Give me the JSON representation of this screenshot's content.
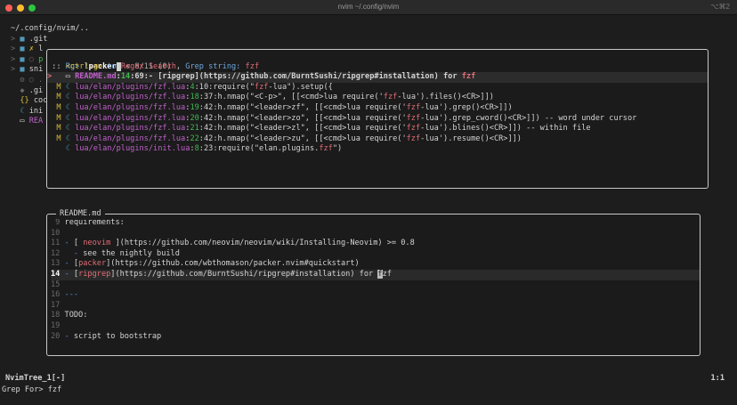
{
  "window": {
    "title": "nvim ~/.config/nvim",
    "shortcut": "⌥⌘2"
  },
  "colors": {
    "bg": "#1d1d1d",
    "path": "#c061cb",
    "num": "#3fb950",
    "mod": "#d7ba37",
    "match": "#e06c75",
    "icon": "#519aba",
    "dim": "#6a6a6a",
    "text": "#d4d4d4",
    "prompt": "#6fa8dc",
    "link": "#e06c75",
    "bullet": "#5b8fd6",
    "bold": "#ffffff"
  },
  "tree": [
    [
      {
        "t": "~/.config/nvim/..",
        "c": "text"
      }
    ],
    [
      {
        "t": "> ",
        "c": "dim"
      },
      {
        "t": "■ ",
        "c": "icon"
      },
      {
        "t": ".git",
        "c": "text"
      }
    ],
    [
      {
        "t": "> ",
        "c": "dim"
      },
      {
        "t": "■ ",
        "c": "icon"
      },
      {
        "t": "✗ ",
        "c": "mod"
      },
      {
        "t": "l",
        "c": "text"
      }
    ],
    [
      {
        "t": "> ",
        "c": "dim"
      },
      {
        "t": "■ ",
        "c": "icon"
      },
      {
        "t": "○ ",
        "c": "dim"
      },
      {
        "t": "p",
        "c": "num"
      }
    ],
    [
      {
        "t": "> ",
        "c": "dim"
      },
      {
        "t": "■ ",
        "c": "icon"
      },
      {
        "t": "sni",
        "c": "text"
      }
    ],
    [
      {
        "t": "  ⚙ ",
        "c": "dim"
      },
      {
        "t": "○ .",
        "c": "dim"
      }
    ],
    [
      {
        "t": "  ◆ ",
        "c": "dim"
      },
      {
        "t": ".gi",
        "c": "text"
      }
    ],
    [
      {
        "t": "  {} ",
        "c": "mod"
      },
      {
        "t": "coc",
        "c": "text"
      }
    ],
    [
      {
        "t": "  ☾ ",
        "c": "icon"
      },
      {
        "t": "ini",
        "c": "text"
      }
    ],
    [
      {
        "t": "  ▭ ",
        "c": "text"
      },
      {
        "t": "REA",
        "c": "path"
      }
    ]
  ],
  "picker": {
    "prompt": "Rg> ",
    "query": "!packer",
    "counter": " < 8/11 (0)",
    "hint": [
      {
        "t": " :: ",
        "c": "text"
      },
      {
        "t": "<ctrl-g>",
        "c": "mod"
      },
      {
        "t": " to ",
        "c": "prompt"
      },
      {
        "t": "Regex Search",
        "c": "match"
      },
      {
        "t": ", ",
        "c": "text"
      },
      {
        "t": "Grep string: ",
        "c": "prompt"
      },
      {
        "t": "fzf",
        "c": "match"
      }
    ],
    "results": [
      {
        "selected": true,
        "segs": [
          {
            "t": "> ",
            "c": "match"
          },
          {
            "t": "  ▭ ",
            "c": "text"
          },
          {
            "t": "README.md",
            "c": "path"
          },
          {
            "t": ":",
            "c": "text"
          },
          {
            "t": "14",
            "c": "num"
          },
          {
            "t": ":69:- [ripgrep](https://github.com/BurntSushi/ripgrep#installation) for ",
            "c": "text"
          },
          {
            "t": "fzf",
            "c": "match"
          }
        ]
      },
      {
        "segs": [
          {
            "t": "  M ",
            "c": "mod"
          },
          {
            "t": "☾ ",
            "c": "icon"
          },
          {
            "t": "lua/elan/plugins/fzf.lua",
            "c": "path"
          },
          {
            "t": ":",
            "c": "text"
          },
          {
            "t": "4",
            "c": "num"
          },
          {
            "t": ":10:require(\"",
            "c": "text"
          },
          {
            "t": "fzf",
            "c": "match"
          },
          {
            "t": "-lua\").setup({",
            "c": "text"
          }
        ]
      },
      {
        "segs": [
          {
            "t": "  M ",
            "c": "mod"
          },
          {
            "t": "☾ ",
            "c": "icon"
          },
          {
            "t": "lua/elan/plugins/fzf.lua",
            "c": "path"
          },
          {
            "t": ":",
            "c": "text"
          },
          {
            "t": "18",
            "c": "num"
          },
          {
            "t": ":37:h.nmap(\"<C-p>\", [[<cmd>lua require('",
            "c": "text"
          },
          {
            "t": "fzf",
            "c": "match"
          },
          {
            "t": "-lua').files()<CR>]])",
            "c": "text"
          }
        ]
      },
      {
        "segs": [
          {
            "t": "  M ",
            "c": "mod"
          },
          {
            "t": "☾ ",
            "c": "icon"
          },
          {
            "t": "lua/elan/plugins/fzf.lua",
            "c": "path"
          },
          {
            "t": ":",
            "c": "text"
          },
          {
            "t": "19",
            "c": "num"
          },
          {
            "t": ":42:h.nmap(\"<leader>zf\", [[<cmd>lua require('",
            "c": "text"
          },
          {
            "t": "fzf",
            "c": "match"
          },
          {
            "t": "-lua').grep()<CR>]])",
            "c": "text"
          }
        ]
      },
      {
        "segs": [
          {
            "t": "  M ",
            "c": "mod"
          },
          {
            "t": "☾ ",
            "c": "icon"
          },
          {
            "t": "lua/elan/plugins/fzf.lua",
            "c": "path"
          },
          {
            "t": ":",
            "c": "text"
          },
          {
            "t": "20",
            "c": "num"
          },
          {
            "t": ":42:h.nmap(\"<leader>zo\", [[<cmd>lua require('",
            "c": "text"
          },
          {
            "t": "fzf",
            "c": "match"
          },
          {
            "t": "-lua').grep_cword()<CR>]]) -- word under cursor",
            "c": "text"
          }
        ]
      },
      {
        "segs": [
          {
            "t": "  M ",
            "c": "mod"
          },
          {
            "t": "☾ ",
            "c": "icon"
          },
          {
            "t": "lua/elan/plugins/fzf.lua",
            "c": "path"
          },
          {
            "t": ":",
            "c": "text"
          },
          {
            "t": "21",
            "c": "num"
          },
          {
            "t": ":42:h.nmap(\"<leader>zl\", [[<cmd>lua require('",
            "c": "text"
          },
          {
            "t": "fzf",
            "c": "match"
          },
          {
            "t": "-lua').blines()<CR>]]) -- within file",
            "c": "text"
          }
        ]
      },
      {
        "segs": [
          {
            "t": "  M ",
            "c": "mod"
          },
          {
            "t": "☾ ",
            "c": "icon"
          },
          {
            "t": "lua/elan/plugins/fzf.lua",
            "c": "path"
          },
          {
            "t": ":",
            "c": "text"
          },
          {
            "t": "22",
            "c": "num"
          },
          {
            "t": ":42:h.nmap(\"<leader>zu\", [[<cmd>lua require('",
            "c": "text"
          },
          {
            "t": "fzf",
            "c": "match"
          },
          {
            "t": "-lua').resume()<CR>]])",
            "c": "text"
          }
        ]
      },
      {
        "segs": [
          {
            "t": "    ",
            "c": "text"
          },
          {
            "t": "☾ ",
            "c": "icon"
          },
          {
            "t": "lua/elan/plugins/init.lua",
            "c": "path"
          },
          {
            "t": ":",
            "c": "text"
          },
          {
            "t": "8",
            "c": "num"
          },
          {
            "t": ":23:require(\"elan.plugins.",
            "c": "text"
          },
          {
            "t": "fzf",
            "c": "match"
          },
          {
            "t": "\")",
            "c": "text"
          }
        ]
      }
    ]
  },
  "preview": {
    "title": "README.md",
    "lines": [
      {
        "n": "9",
        "segs": [
          {
            "t": "requirements:",
            "c": "text"
          }
        ]
      },
      {
        "n": "10",
        "segs": []
      },
      {
        "n": "11",
        "segs": [
          {
            "t": "- ",
            "c": "bullet"
          },
          {
            "t": "[ ",
            "c": "text"
          },
          {
            "t": "neovim",
            "c": "link"
          },
          {
            "t": " ](https://github.com/neovim/neovim/wiki/Installing-Neovim) >= 0.8",
            "c": "text"
          }
        ]
      },
      {
        "n": "12",
        "segs": [
          {
            "t": "  - ",
            "c": "bullet"
          },
          {
            "t": "see the nightly build",
            "c": "text"
          }
        ]
      },
      {
        "n": "13",
        "segs": [
          {
            "t": "- ",
            "c": "bullet"
          },
          {
            "t": "[",
            "c": "text"
          },
          {
            "t": "packer",
            "c": "link"
          },
          {
            "t": "](https://github.com/wbthomason/packer.nvim#quickstart)",
            "c": "text"
          }
        ]
      },
      {
        "n": "14",
        "current": true,
        "segs": [
          {
            "t": "- ",
            "c": "bullet"
          },
          {
            "t": "[",
            "c": "text"
          },
          {
            "t": "ripgrep",
            "c": "link"
          },
          {
            "t": "](https://github.com/BurntSushi/ripgrep#installation) for ",
            "c": "text"
          },
          {
            "t": "f",
            "c": "cursor"
          },
          {
            "t": "zf",
            "c": "text"
          }
        ]
      },
      {
        "n": "15",
        "segs": []
      },
      {
        "n": "16",
        "segs": [
          {
            "t": "---",
            "c": "bullet"
          }
        ]
      },
      {
        "n": "17",
        "segs": []
      },
      {
        "n": "18",
        "segs": [
          {
            "t": "TODO:",
            "c": "text"
          }
        ]
      },
      {
        "n": "19",
        "segs": []
      },
      {
        "n": "20",
        "segs": [
          {
            "t": "- ",
            "c": "bullet"
          },
          {
            "t": "script to bootstrap",
            "c": "text"
          }
        ]
      }
    ]
  },
  "statusline": {
    "name": "NvimTree_1[-]",
    "position": "1:1"
  },
  "cmdline": {
    "text": "Grep For> fzf"
  }
}
